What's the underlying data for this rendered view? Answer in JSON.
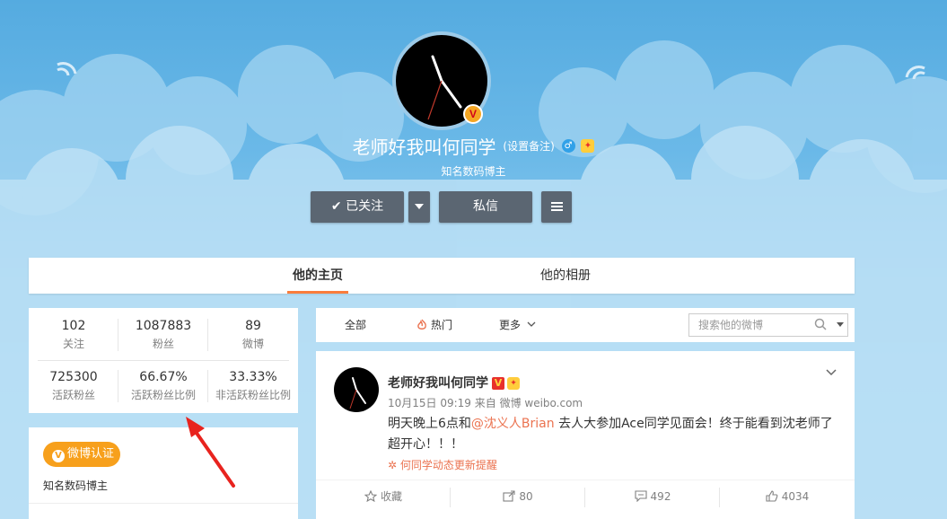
{
  "profile": {
    "name": "老师好我叫何同学",
    "remark_link": "(设置备注)",
    "gender_icon": "male-icon",
    "bio": "知名数码博主",
    "buttons": {
      "follow": "已关注",
      "message": "私信"
    }
  },
  "tabs": [
    {
      "label": "他的主页",
      "active": true
    },
    {
      "label": "他的相册",
      "active": false
    }
  ],
  "stats": {
    "row1": [
      {
        "value": "102",
        "label": "关注"
      },
      {
        "value": "1087883",
        "label": "粉丝"
      },
      {
        "value": "89",
        "label": "微博"
      }
    ],
    "row2": [
      {
        "value": "725300",
        "label": "活跃粉丝"
      },
      {
        "value": "66.67%",
        "label": "活跃粉丝比例"
      },
      {
        "value": "33.33%",
        "label": "非活跃粉丝比例"
      }
    ]
  },
  "verification": {
    "badge": "微博认证",
    "text": "知名数码博主"
  },
  "filter": {
    "all": "全部",
    "hot": "热门",
    "more": "更多",
    "search_placeholder": "搜索他的微博"
  },
  "post": {
    "author": "老师好我叫何同学",
    "meta": "10月15日 09:19 来自 微博 weibo.com",
    "text_before": "明天晚上6点和",
    "mention": "@沈义人Brian",
    "text_after": " 去人大参加Ace同学见面会！终于能看到沈老师了超开心！！！",
    "remind": "何同学动态更新提醒",
    "actions": {
      "favorite": "收藏",
      "repost": "80",
      "comment": "492",
      "like": "4034"
    }
  },
  "colors": {
    "accent": "#fa7d3c",
    "link": "#eb7350",
    "verify": "#f7a01c",
    "button": "#5b6672"
  }
}
